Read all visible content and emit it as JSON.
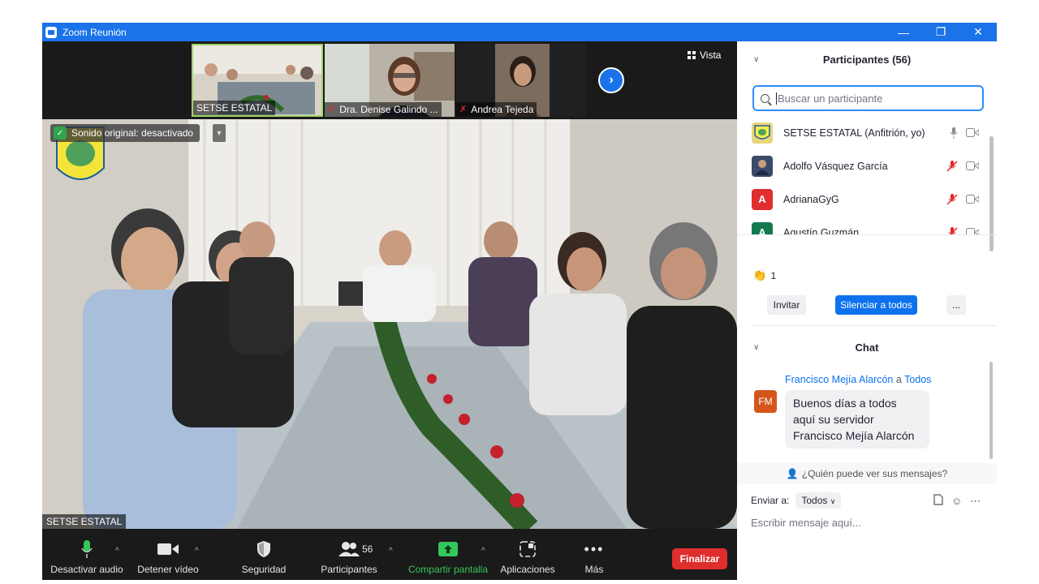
{
  "window": {
    "title": "Zoom Reunión"
  },
  "strip": {
    "thumbnails": [
      {
        "name": "SETSE ESTATAL",
        "muted": false
      },
      {
        "name": "Dra. Denise Galindo ...",
        "muted": true
      },
      {
        "name": "Andrea Tejeda",
        "muted": true
      }
    ],
    "view_label": "Vista"
  },
  "main": {
    "sound_badge": "Sonido original: desactivado",
    "speaker_name": "SETSE ESTATAL"
  },
  "toolbar": {
    "mute_label": "Desactivar audio",
    "video_label": "Detener vídeo",
    "security_label": "Seguridad",
    "participants_label": "Participantes",
    "participants_count": "56",
    "share_label": "Compartir pantalla",
    "apps_label": "Aplicaciones",
    "more_label": "Más",
    "end_label": "Finalizar"
  },
  "participants": {
    "title": "Participantes (56)",
    "search_placeholder": "Buscar un participante",
    "rows": [
      {
        "name": "SETSE ESTATAL (Anfitrión, yo)",
        "avatar": "",
        "color": "#e8d67a",
        "muted": false
      },
      {
        "name": "Adolfo Vásquez García",
        "avatar": "",
        "color": "#3a4a6a",
        "muted": true
      },
      {
        "name": "AdrianaGyG",
        "avatar": "A",
        "color": "#e02d2d",
        "muted": true
      },
      {
        "name": "Agustín Guzmán",
        "avatar": "A",
        "color": "#127a4e",
        "muted": true
      }
    ],
    "reaction_count": "1",
    "invite_label": "Invitar",
    "mute_all_label": "Silenciar a todos",
    "more_label": "..."
  },
  "chat": {
    "title": "Chat",
    "from": "Francisco Mejía Alarcón",
    "to_word": "a",
    "to": "Todos",
    "avatar": "FM",
    "message_lines": [
      "Buenos días a todos",
      "aquí su servidor",
      "Francisco Mejía Alarcón"
    ],
    "who_can_see": "¿Quién puede ver sus mensajes?",
    "send_to_label": "Enviar a:",
    "send_to_value": "Todos",
    "input_placeholder": "Escribir mensaje aquí..."
  }
}
